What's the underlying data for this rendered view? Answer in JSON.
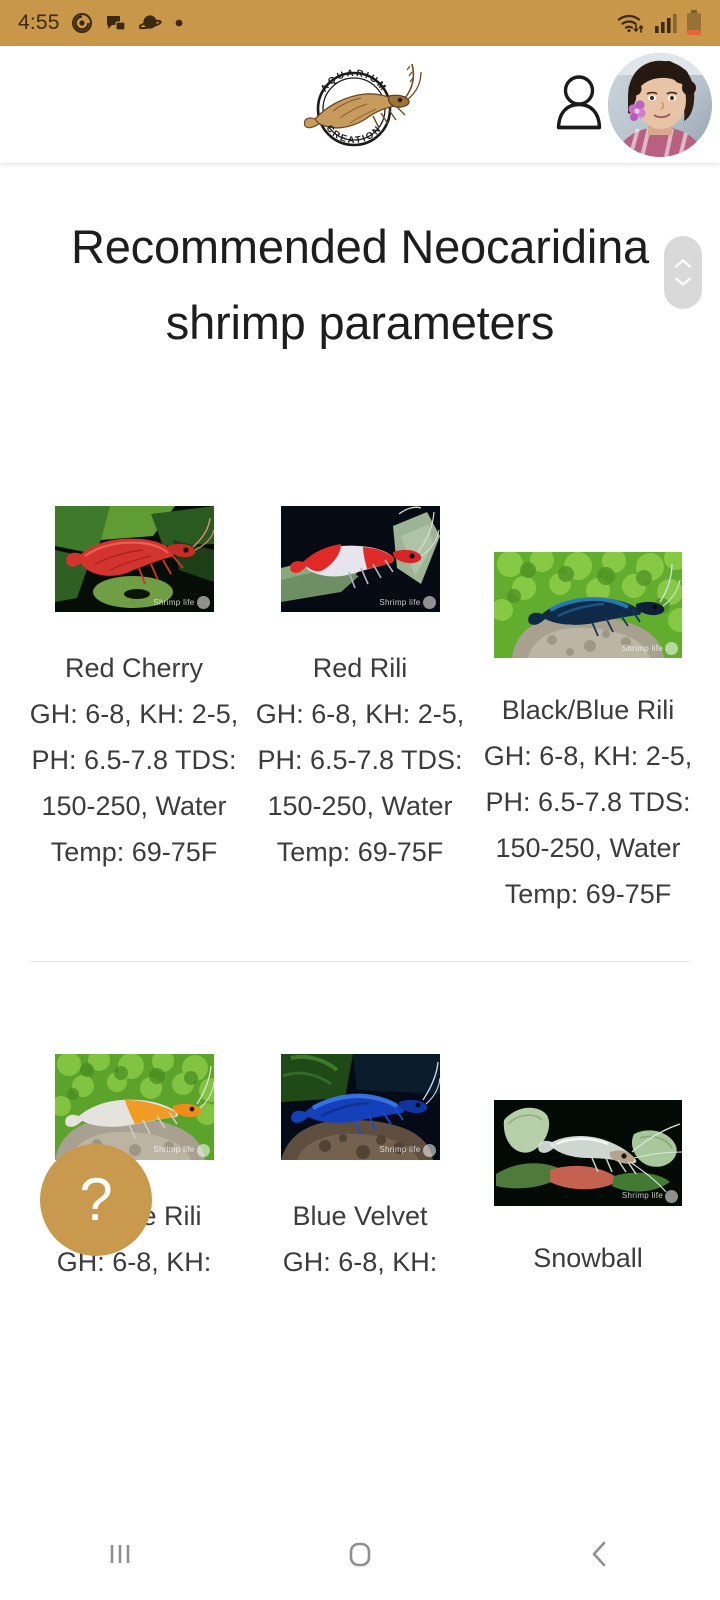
{
  "statusbar": {
    "time": "4:55",
    "left_icons": [
      "spiral-notification-icon",
      "messaging-notification-icon",
      "saturn-notification-icon",
      "dot-notification-icon"
    ],
    "right_icons": [
      "wifi-icon",
      "cellular-signal-icon",
      "battery-icon"
    ],
    "background_color": "#c9974a",
    "foreground_color": "#3b2a10"
  },
  "header": {
    "logo": {
      "icon": "aquarium-creation-logo",
      "top_text": "AQUARIUM",
      "bottom_text": "CREATION"
    },
    "account_icon": "account-person-icon",
    "avatar": "user-avatar-photo"
  },
  "scroll_widget": {
    "up_icon": "chevron-up-icon",
    "down_icon": "chevron-down-icon",
    "background_color": "#d9d9d9"
  },
  "main": {
    "title": "Recommended Neocaridina shrimp parameters",
    "rows": [
      {
        "cards": [
          {
            "name": "Red Cherry",
            "spec": "GH: 6-8, KH: 2-5, PH: 6.5-7.8 TDS: 150-250, Water Temp: 69-75F",
            "image": "red-cherry-shrimp-photo",
            "watermark": "Shrimp life"
          },
          {
            "name": "Red Rili",
            "spec": "GH: 6-8, KH: 2-5, PH: 6.5-7.8 TDS: 150-250, Water Temp: 69-75F",
            "image": "red-rili-shrimp-photo",
            "watermark": "Shrimp life"
          },
          {
            "name": "Black/Blue Rili",
            "spec": "GH: 6-8, KH: 2-5, PH: 6.5-7.8 TDS: 150-250, Water Temp: 69-75F",
            "image": "black-blue-rili-shrimp-photo",
            "watermark": "Shrimp life"
          }
        ]
      },
      {
        "cards": [
          {
            "name": "Orange Rili",
            "spec": "GH: 6-8, KH:",
            "image": "orange-rili-shrimp-photo",
            "watermark": "Shrimp life"
          },
          {
            "name": "Blue Velvet",
            "spec": "GH: 6-8, KH:",
            "image": "blue-velvet-shrimp-photo",
            "watermark": "Shrimp life"
          },
          {
            "name": "Snowball",
            "spec": "",
            "image": "snowball-shrimp-photo",
            "watermark": "Shrimp life"
          }
        ]
      }
    ]
  },
  "help_fab": {
    "label": "?",
    "color": "#c99a4e"
  },
  "navbar": {
    "recents_icon": "recents-icon",
    "home_icon": "home-icon",
    "back_icon": "back-icon"
  }
}
